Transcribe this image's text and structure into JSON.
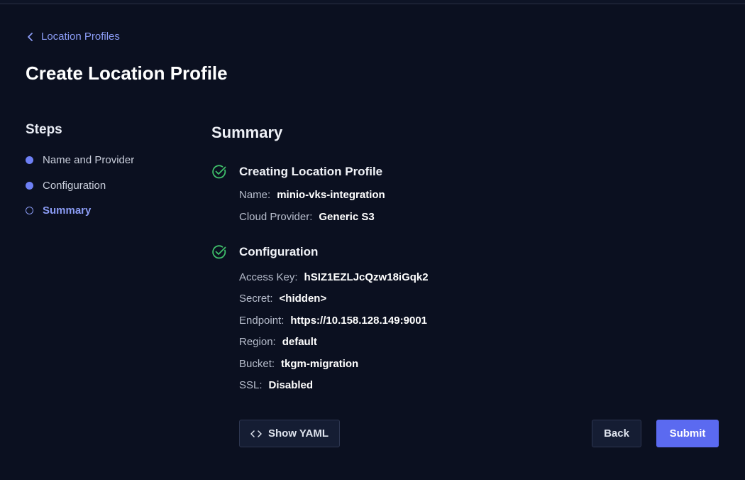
{
  "breadcrumb": {
    "label": "Location Profiles"
  },
  "page": {
    "title": "Create Location Profile"
  },
  "steps": {
    "title": "Steps",
    "items": [
      {
        "label": "Name and Provider",
        "state": "complete"
      },
      {
        "label": "Configuration",
        "state": "complete"
      },
      {
        "label": "Summary",
        "state": "current"
      }
    ]
  },
  "summary": {
    "title": "Summary",
    "creating": {
      "label": "Creating Location Profile",
      "name_key": "Name:",
      "name_value": "minio-vks-integration",
      "provider_key": "Cloud Provider:",
      "provider_value": "Generic S3"
    },
    "configuration": {
      "label": "Configuration",
      "access_key_key": "Access Key:",
      "access_key_value": "hSIZ1EZLJcQzw18iGqk2",
      "secret_key": "Secret:",
      "secret_value": "<hidden>",
      "endpoint_key": "Endpoint:",
      "endpoint_value": "https://10.158.128.149:9001",
      "region_key": "Region:",
      "region_value": "default",
      "bucket_key": "Bucket:",
      "bucket_value": "tkgm-migration",
      "ssl_key": "SSL:",
      "ssl_value": "Disabled"
    }
  },
  "actions": {
    "show_yaml": "Show YAML",
    "back": "Back",
    "submit": "Submit"
  },
  "colors": {
    "background": "#0b1020",
    "accent": "#5b6af0",
    "link": "#8b9cf5",
    "success": "#3fbf6a"
  },
  "icons": {
    "breadcrumb": "chevron-left-icon",
    "section_status": "check-circle-icon",
    "yaml": "code-icon"
  }
}
